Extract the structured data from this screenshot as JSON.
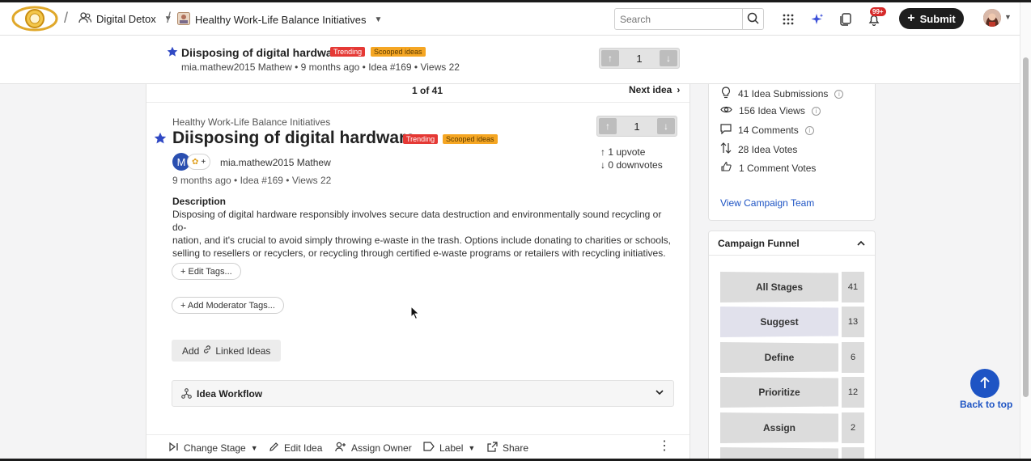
{
  "topbar": {
    "breadcrumb": [
      {
        "label": "Digital Detox"
      },
      {
        "label": "Healthy Work-Life Balance Initiatives"
      }
    ],
    "search_placeholder": "Search",
    "notifications_badge": "99+",
    "submit_label": "Submit"
  },
  "sticky": {
    "title": "Diisposing of digital hardware",
    "tag_trending": "Trending",
    "tag_scooped": "Scooped ideas",
    "meta": "mia.mathew2015 Mathew • 9 months ago • Idea #169 • Views 22",
    "vote_count": "1"
  },
  "pager": {
    "position": "1 of 41",
    "next_label": "Next idea"
  },
  "idea": {
    "campaign": "Healthy Work-Life Balance Initiatives",
    "title": "Diisposing of digital hardware",
    "tag_trending": "Trending",
    "tag_scooped": "Scooped ideas",
    "avatar_initial": "M",
    "author": "mia.mathew2015 Mathew",
    "meta": "9 months ago • Idea #169 • Views 22",
    "vote_count": "1",
    "upvotes": "1 upvote",
    "downvotes": "0 downvotes",
    "description_heading": "Description",
    "description_lines": [
      "Disposing of digital hardware responsibly involves secure data destruction and environmentally sound recycling or do-",
      "nation, and it's crucial to avoid simply throwing e-waste in the trash. Options include donating to charities or schools,",
      "selling to resellers or recyclers, or recycling through certified e-waste programs or retailers with recycling initiatives."
    ],
    "edit_tags": "+ Edit Tags...",
    "add_moderator_tags": "+ Add Moderator Tags...",
    "add_linked_prefix": "Add",
    "add_linked_suffix": "Linked Ideas",
    "workflow_label": "Idea Workflow"
  },
  "actions": {
    "change_stage": "Change Stage",
    "edit_idea": "Edit Idea",
    "assign_owner": "Assign Owner",
    "label": "Label",
    "share": "Share"
  },
  "stats": {
    "submissions": "41 Idea Submissions",
    "views": "156 Idea Views",
    "comments": "14 Comments",
    "votes": "28 Idea Votes",
    "comment_votes": "1 Comment Votes",
    "view_team": "View Campaign Team"
  },
  "funnel": {
    "title": "Campaign Funnel",
    "stages": [
      {
        "label": "All Stages",
        "count": "41"
      },
      {
        "label": "Suggest",
        "count": "13"
      },
      {
        "label": "Define",
        "count": "6"
      },
      {
        "label": "Prioritize",
        "count": "12"
      },
      {
        "label": "Assign",
        "count": "2"
      }
    ]
  },
  "back_to_top": "Back to top",
  "colors": {
    "trending": "#e53935",
    "scooped": "#f5a623",
    "accent_blue": "#1e54c4",
    "submit_bg": "#1e1e1e"
  }
}
